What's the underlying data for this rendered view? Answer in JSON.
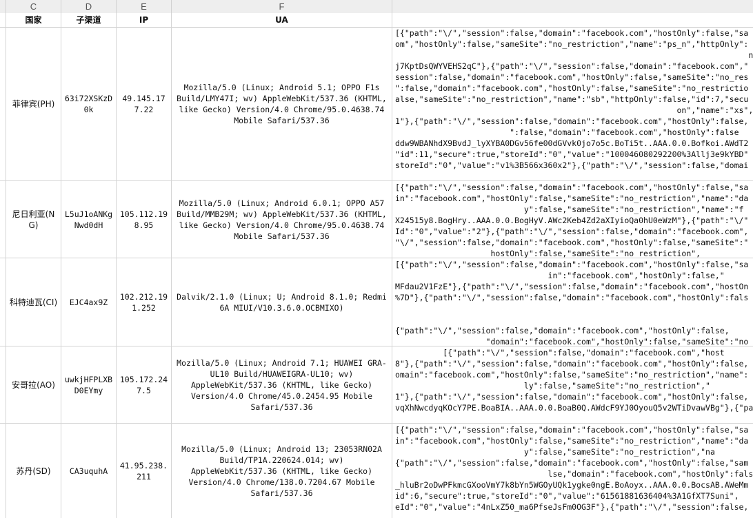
{
  "column_letters": [
    "C",
    "D",
    "E",
    "F"
  ],
  "headers": {
    "country": "国家",
    "sub_channel": "子渠道",
    "ip": "IP",
    "ua": "UA"
  },
  "rows": [
    {
      "country": "菲律宾(PH)",
      "channel": "63i72XSKzD0k",
      "ip": "49.145.177.22",
      "ua": "Mozilla/5.0 (Linux; Android 5.1; OPPO F1s Build/LMY47I; wv) AppleWebKit/537.36 (KHTML, like Gecko) Version/4.0 Chrome/95.0.4638.74 Mobile Safari/537.36",
      "cookie_lines": [
        "[{\"path\":\"\\/\",\"session\":false,\"domain\":\"facebook.com\",\"hostOnly\":false,\"sa",
        "om\",\"hostOnly\":false,\"sameSite\":\"no_restriction\",\"name\":\"ps_n\",\"httpOnly\":",
        "                                                                          n",
        "j7KptDsQWYVEHS2qC\"},{\"path\":\"\\/\",\"session\":false,\"domain\":\"facebook.com\",\"",
        "session\":false,\"domain\":\"facebook.com\",\"hostOnly\":false,\"sameSite\":\"no_res",
        "\":false,\"domain\":\"facebook.com\",\"hostOnly\":false,\"sameSite\":\"no_restrictio",
        "alse,\"sameSite\":\"no_restriction\",\"name\":\"sb\",\"httpOnly\":false,\"id\":7,\"secu",
        "                                                           on\",\"name\":\"xs\",\"http",
        "1\"},{\"path\":\"\\/\",\"session\":false,\"domain\":\"facebook.com\",\"hostOnly\":false,",
        "                        \":false,\"domain\":\"facebook.com\",\"hostOnly\":false",
        "ddw9WBANhdX9BvdJ_lyXYBA0DGv56fe00dGVvk0jo7o5c.BoTi5t..AAA.0.0.Bofkoi.AWdT2",
        "\"id\":11,\"secure\":true,\"storeId\":\"0\",\"value\":\"100046080292200%3Allj3e9kYBD\"",
        "storeId\":\"0\",\"value\":\"v1%3B566x360x2\"},{\"path\":\"\\/\",\"session\":false,\"domai"
      ]
    },
    {
      "country": "尼日利亚(NG)",
      "channel": "L5uJ1oANKgNwd0dH",
      "ip": "105.112.198.95",
      "ua": "Mozilla/5.0 (Linux; Android 6.0.1; OPPO A57 Build/MMB29M; wv) AppleWebKit/537.36 (KHTML, like Gecko) Version/4.0 Chrome/95.0.4638.74 Mobile Safari/537.36",
      "cookie_lines": [
        "[{\"path\":\"\\/\",\"session\":false,\"domain\":\"facebook.com\",\"hostOnly\":false,\"sa",
        "in\":\"facebook.com\",\"hostOnly\":false,\"sameSite\":\"no_restriction\",\"name\":\"da",
        "                           y\":false,\"sameSite\":\"no_restriction\",\"name\":\"f",
        "X24515y8.BogHry..AAA.0.0.BogHyV.AWc2Keb4Zd2aXIyioQa0hU0eWzM\"},{\"path\":\"\\/\"",
        "Id\":\"0\",\"value\":\"2\"},{\"path\":\"\\/\",\"session\":false,\"domain\":\"facebook.com\",",
        "\"\\/\",\"session\":false,\"domain\":\"facebook.com\",\"hostOnly\":false,\"sameSite\":\"",
        "                    hostOnly\":false,\"sameSite\":\"no_restriction\","
      ]
    },
    {
      "country": "科特迪瓦(CI)",
      "channel": "EJC4ax9Z",
      "ip": "102.212.191.252",
      "ua": "Dalvik/2.1.0 (Linux; U; Android 8.1.0; Redmi 6A MIUI/V10.3.6.0.OCBMIXO)",
      "cookie_lines": [
        "[{\"path\":\"\\/\",\"session\":false,\"domain\":\"facebook.com\",\"hostOnly\":false,\"sa",
        "                                in\":\"facebook.com\",\"hostOnly\":false,\"",
        "MFdau2V1FzE\"},{\"path\":\"\\/\",\"session\":false,\"domain\":\"facebook.com\",\"hostOn",
        "%7D\"},{\"path\":\"\\/\",\"session\":false,\"domain\":\"facebook.com\",\"hostOnly\":fals",
        "",
        "",
        "{\"path\":\"\\/\",\"session\":false,\"domain\":\"facebook.com\",\"hostOnly\":false,",
        "                   \"domain\":\"facebook.com\",\"hostOnly\":false,\"sameSite\":\"no_"
      ]
    },
    {
      "country": "安哥拉(AO)",
      "channel": "uwkjHFPLXBD0EYmy",
      "ip": "105.172.247.5",
      "ua": "Mozilla/5.0 (Linux; Android 7.1; HUAWEI GRA-UL10 Build/HUAWEIGRA-UL10; wv) AppleWebKit/537.36 (KHTML, like Gecko) Version/4.0 Chrome/45.0.2454.95 Mobile Safari/537.36",
      "cookie_lines": [
        "          [{\"path\":\"\\/\",\"session\":false,\"domain\":\"facebook.com\",\"host",
        "8\"},{\"path\":\"\\/\",\"session\":false,\"domain\":\"facebook.com\",\"hostOnly\":false,",
        "omain\":\"facebook.com\",\"hostOnly\":false,\"sameSite\":\"no_restriction\",\"name\":",
        "                           ly\":false,\"sameSite\":\"no_restriction\",\"",
        "1\"},{\"path\":\"\\/\",\"session\":false,\"domain\":\"facebook.com\",\"hostOnly\":false,",
        "vqXhNwcdyqKOcY7PE.BoaBIA..AAA.0.0.BoaB0Q.AWdcF9YJ0OyouQ5v2WTiDvawVBg\"},{\"path"
      ]
    },
    {
      "country": "苏丹(SD)",
      "channel": "CA3uquhA",
      "ip": "41.95.238.211",
      "ua": "Mozilla/5.0 (Linux; Android 13; 23053RN02A Build/TP1A.220624.014; wv) AppleWebKit/537.36 (KHTML, like Gecko) Version/4.0 Chrome/138.0.7204.67 Mobile Safari/537.36",
      "cookie_lines": [
        "[{\"path\":\"\\/\",\"session\":false,\"domain\":\"facebook.com\",\"hostOnly\":false,\"sa",
        "in\":\"facebook.com\",\"hostOnly\":false,\"sameSite\":\"no_restriction\",\"name\":\"da",
        "                           y\":false,\"sameSite\":\"no_restriction\",\"na",
        "{\"path\":\"\\/\",\"session\":false,\"domain\":\"facebook.com\",\"hostOnly\":false,\"sam",
        "                                lse,\"domain\":\"facebook.com\",\"hostOnly\":false,\"",
        "_hluBr2oDwPFkmcGXooVmY7k8bYn5WGOyUQk1ygke0ngE.BoAoyx..AAA.0.0.BocsAB.AWeMm",
        "id\":6,\"secure\":true,\"storeId\":\"0\",\"value\":\"61561881636404%3A1GfXT7Suni\",",
        "eId\":\"0\",\"value\":\"4nLxZ50_ma6PfseJsFm0OG3F\"},{\"path\":\"\\/\",\"session\":false,"
      ]
    }
  ]
}
